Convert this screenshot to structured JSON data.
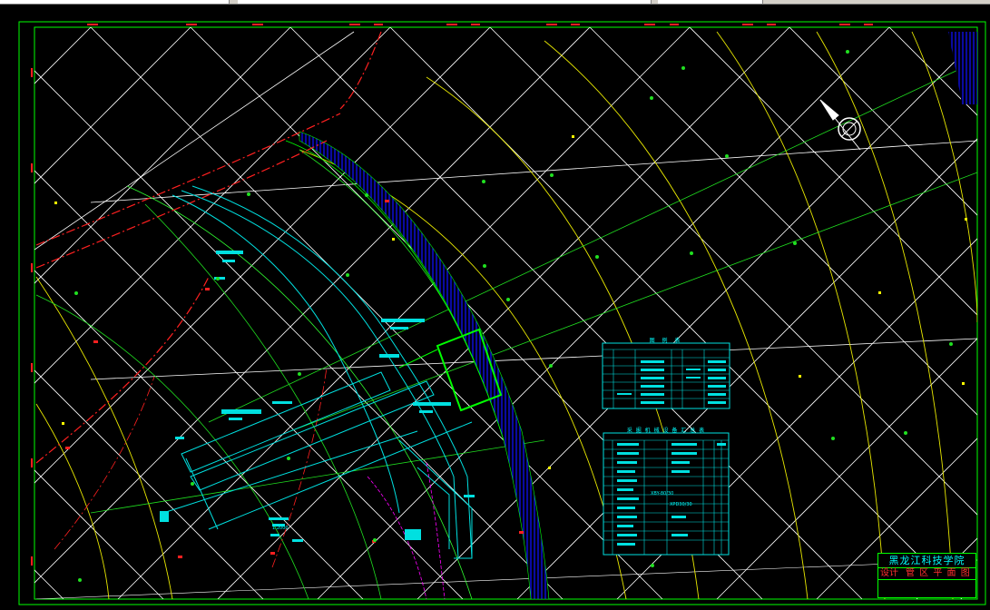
{
  "window": {
    "app": "CAD drawing viewer",
    "colors": {
      "background": "#000000",
      "frame": "#00ff00",
      "grid": "#ffffff",
      "contour": "#ffff00",
      "cyan": "#00ffff",
      "red": "#ff2020",
      "magenta": "#ff00ff",
      "blue_hatch": "#0000ff"
    }
  },
  "drawing": {
    "title_block": {
      "title": "黑龙江科技学院",
      "subtitle": "管 区 平 面 图",
      "row_label": "设计"
    },
    "legend_table_1": {
      "title": "图 例 表"
    },
    "legend_table_2": {
      "title": "采 掘 机 械 设 备 汇 总 表"
    },
    "labels": {
      "scale_label": "1:2000",
      "equipment_label_1": "XBY-80/30",
      "equipment_label_2": "XPD30/30"
    },
    "icons": [
      "north-arrow-icon",
      "compass-rose-icon"
    ]
  }
}
